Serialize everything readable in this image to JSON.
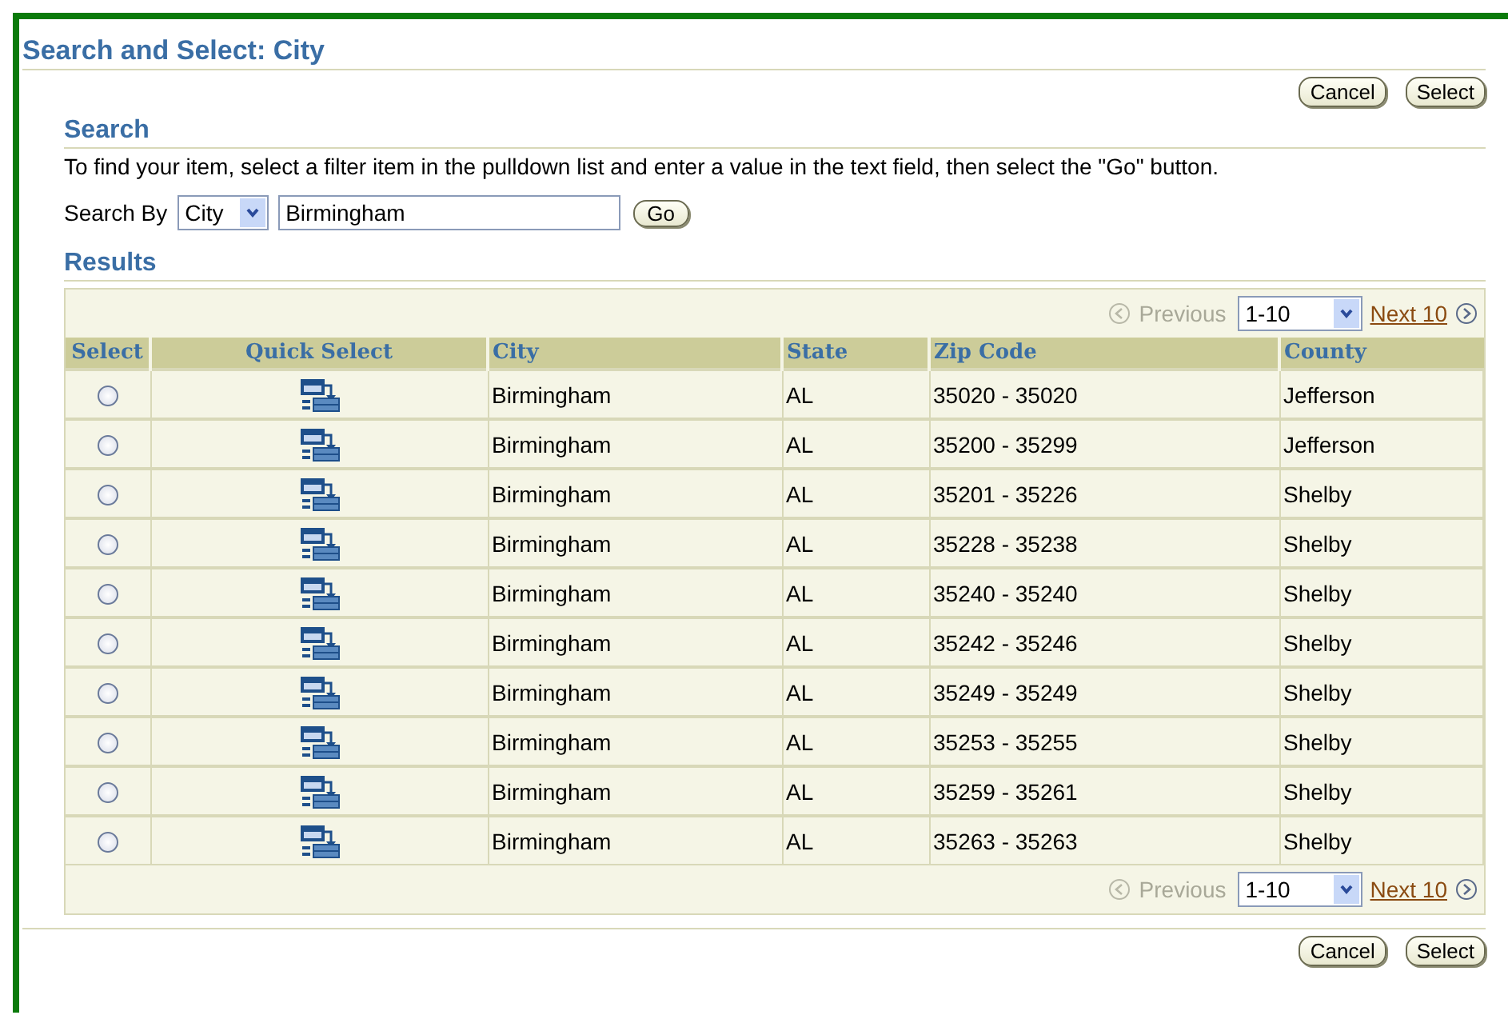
{
  "title": "Search and Select: City",
  "top_buttons": [
    "Cancel",
    "Select"
  ],
  "search": {
    "heading": "Search",
    "instructions": "To find your item, select a filter item in the pulldown list and enter a value in the text field, then select the \"Go\" button.",
    "label": "Search By",
    "filter": "City",
    "value": "Birmingham",
    "go": "Go"
  },
  "results": {
    "heading": "Results",
    "pager_top": {
      "previous": "Previous",
      "range": "1-10",
      "next": "Next 10"
    },
    "columns": [
      "Select",
      "Quick Select",
      "City",
      "State",
      "Zip Code",
      "County"
    ],
    "rows": [
      {
        "selected": false,
        "city": "Birmingham",
        "state": "AL",
        "zip": "35020 - 35020",
        "county": "Jefferson"
      },
      {
        "selected": false,
        "city": "Birmingham",
        "state": "AL",
        "zip": "35200 - 35299",
        "county": "Jefferson"
      },
      {
        "selected": false,
        "city": "Birmingham",
        "state": "AL",
        "zip": "35201 - 35226",
        "county": "Shelby"
      },
      {
        "selected": false,
        "city": "Birmingham",
        "state": "AL",
        "zip": "35228 - 35238",
        "county": "Shelby"
      },
      {
        "selected": false,
        "city": "Birmingham",
        "state": "AL",
        "zip": "35240 - 35240",
        "county": "Shelby"
      },
      {
        "selected": false,
        "city": "Birmingham",
        "state": "AL",
        "zip": "35242 - 35246",
        "county": "Shelby"
      },
      {
        "selected": false,
        "city": "Birmingham",
        "state": "AL",
        "zip": "35249 - 35249",
        "county": "Shelby"
      },
      {
        "selected": false,
        "city": "Birmingham",
        "state": "AL",
        "zip": "35253 - 35255",
        "county": "Shelby"
      },
      {
        "selected": false,
        "city": "Birmingham",
        "state": "AL",
        "zip": "35259 - 35261",
        "county": "Shelby"
      },
      {
        "selected": false,
        "city": "Birmingham",
        "state": "AL",
        "zip": "35263 - 35263",
        "county": "Shelby"
      }
    ],
    "pager_bottom": {
      "previous": "Previous",
      "range": "1-10",
      "next": "Next 10"
    }
  },
  "bottom_buttons": [
    "Cancel",
    "Select"
  ]
}
